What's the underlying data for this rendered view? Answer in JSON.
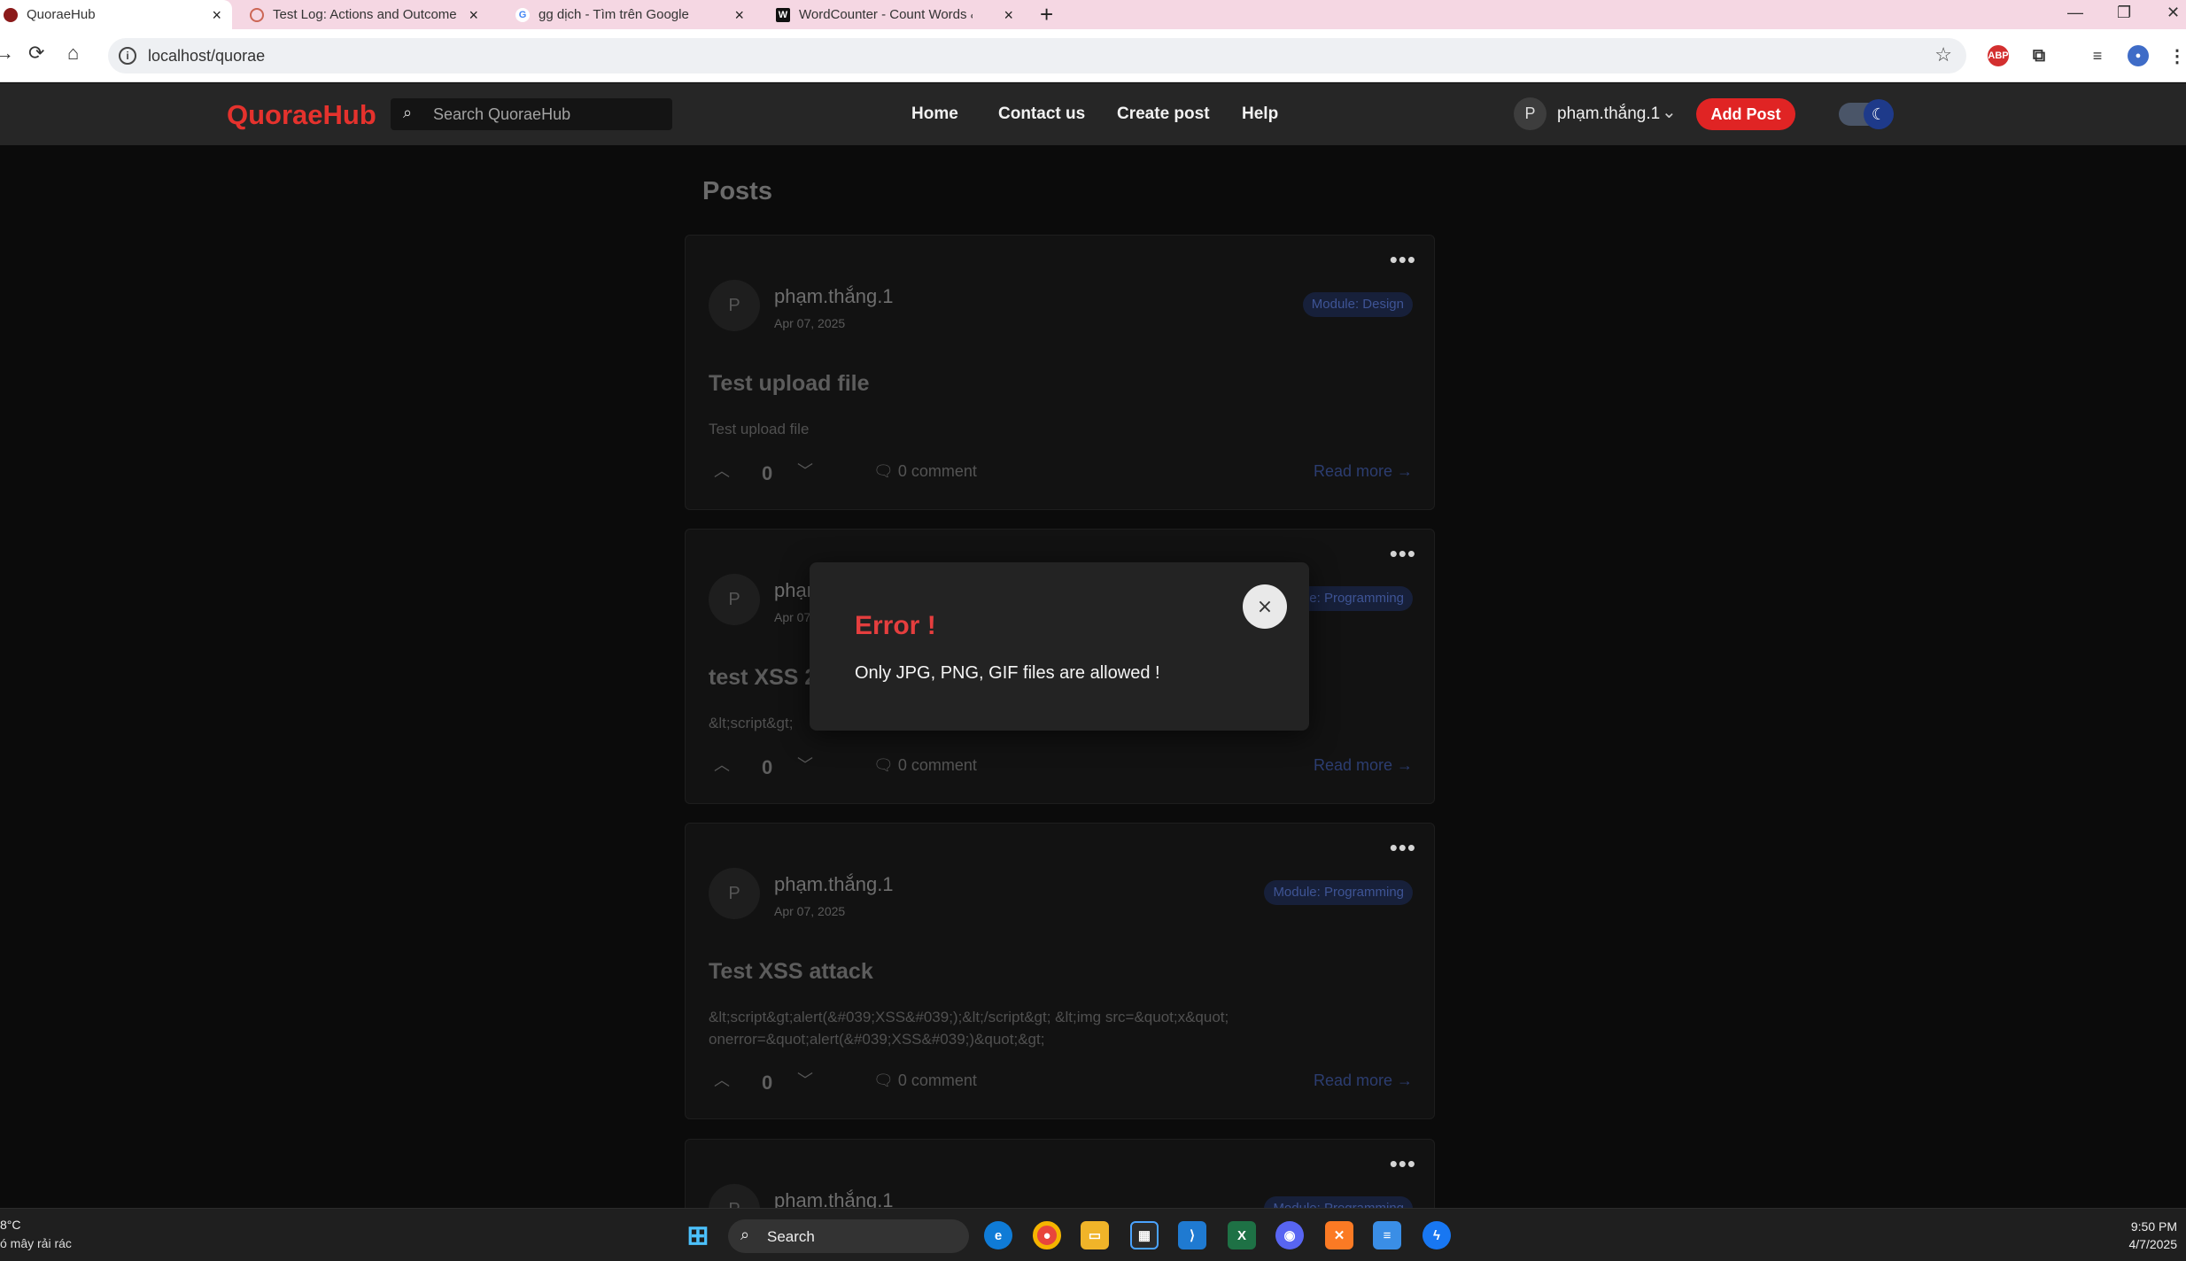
{
  "browser": {
    "tabs": [
      {
        "title": "QuoraeHub",
        "active": true,
        "icon": "quoraehub-favicon"
      },
      {
        "title": "Test Log: Actions and Outcome",
        "active": false,
        "icon": "openai-favicon"
      },
      {
        "title": "gg dịch - Tìm trên Google",
        "active": false,
        "icon": "google-favicon"
      },
      {
        "title": "WordCounter - Count Words &",
        "active": false,
        "icon": "wordcounter-favicon"
      }
    ],
    "url": "localhost/quorae"
  },
  "header": {
    "logo": "QuoraeHub",
    "search_placeholder": "Search QuoraeHub",
    "nav": [
      "Home",
      "Contact us",
      "Create post",
      "Help"
    ],
    "user_initial": "P",
    "user_name": "phạm.thắng.1",
    "add_post_label": "Add Post"
  },
  "main": {
    "heading": "Posts",
    "posts": [
      {
        "initial": "P",
        "author": "phạm.thắng.1",
        "date": "Apr 07, 2025",
        "module": "Module: Design",
        "title": "Test upload file",
        "excerpt": "Test upload file",
        "score": "0",
        "comments": "0 comment",
        "read_more": "Read more →"
      },
      {
        "initial": "P",
        "author": "phạm.thắng.1",
        "date": "Apr 07, 2025",
        "module": "Module: Programming",
        "title": "test XSS 2",
        "excerpt": "&lt;script&gt;",
        "score": "0",
        "comments": "0 comment",
        "read_more": "Read more →"
      },
      {
        "initial": "P",
        "author": "phạm.thắng.1",
        "date": "Apr 07, 2025",
        "module": "Module: Programming",
        "title": "Test XSS attack",
        "excerpt": "&lt;script&gt;alert(&#039;XSS&#039;);&lt;/script&gt; &lt;img src=&quot;x&quot; onerror=&quot;alert(&#039;XSS&#039;)&quot;&gt;",
        "score": "0",
        "comments": "0 comment",
        "read_more": "Read more →"
      },
      {
        "initial": "P",
        "author": "phạm.thắng.1",
        "module": "Module: Programming"
      }
    ]
  },
  "modal": {
    "title": "Error !",
    "message": "Only JPG, PNG, GIF files are allowed !",
    "close": "×"
  },
  "taskbar": {
    "weather_temp": "8°C",
    "weather_desc": "ó mây rải rác",
    "search_label": "Search",
    "time": "9:50 PM",
    "date": "4/7/2025"
  },
  "colors": {
    "brand": "#e5322d",
    "error": "#e53e3e",
    "add_post": "#e02424"
  }
}
